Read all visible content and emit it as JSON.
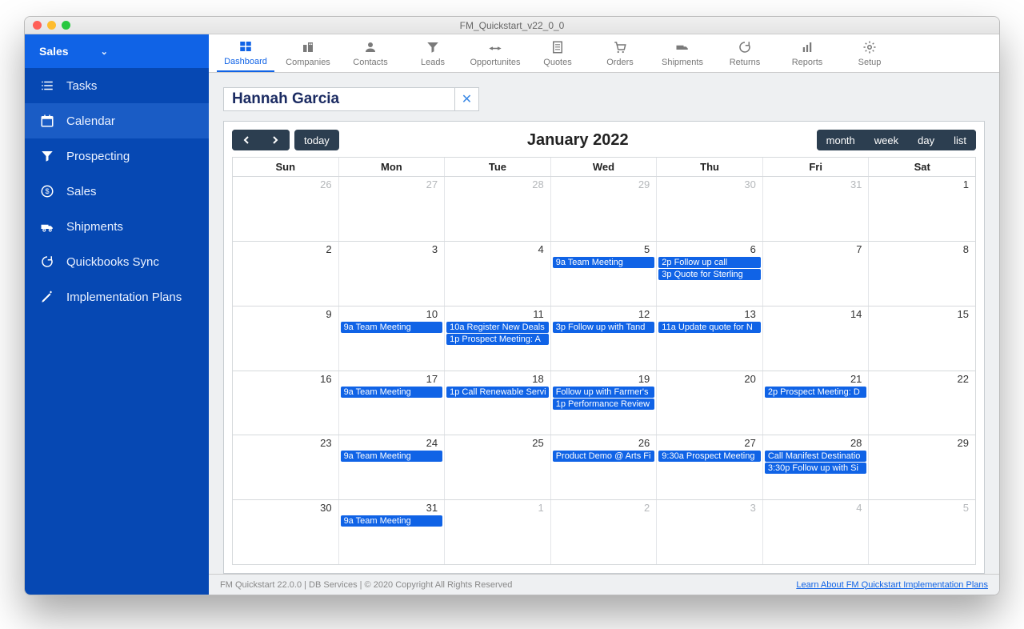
{
  "window_title": "FM_Quickstart_v22_0_0",
  "sidebar": {
    "header": "Sales",
    "items": [
      {
        "label": "Tasks",
        "icon": "list"
      },
      {
        "label": "Calendar",
        "icon": "calendar",
        "active": true
      },
      {
        "label": "Prospecting",
        "icon": "funnel"
      },
      {
        "label": "Sales",
        "icon": "money"
      },
      {
        "label": "Shipments",
        "icon": "truck"
      },
      {
        "label": "Quickbooks Sync",
        "icon": "sync"
      },
      {
        "label": "Implementation Plans",
        "icon": "pen"
      }
    ]
  },
  "toolbar": [
    {
      "label": "Dashboard",
      "active": true
    },
    {
      "label": "Companies"
    },
    {
      "label": "Contacts"
    },
    {
      "label": "Leads"
    },
    {
      "label": "Opportunites"
    },
    {
      "label": "Quotes"
    },
    {
      "label": "Orders"
    },
    {
      "label": "Shipments"
    },
    {
      "label": "Returns"
    },
    {
      "label": "Reports"
    },
    {
      "label": "Setup"
    }
  ],
  "user_name": "Hannah Garcia",
  "calendar": {
    "title": "January 2022",
    "today_label": "today",
    "views": [
      "month",
      "week",
      "day",
      "list"
    ],
    "day_headers": [
      "Sun",
      "Mon",
      "Tue",
      "Wed",
      "Thu",
      "Fri",
      "Sat"
    ],
    "weeks": [
      [
        {
          "num": "26",
          "other": true
        },
        {
          "num": "27",
          "other": true
        },
        {
          "num": "28",
          "other": true
        },
        {
          "num": "29",
          "other": true
        },
        {
          "num": "30",
          "other": true
        },
        {
          "num": "31",
          "other": true
        },
        {
          "num": "1"
        }
      ],
      [
        {
          "num": "2"
        },
        {
          "num": "3"
        },
        {
          "num": "4"
        },
        {
          "num": "5",
          "events": [
            "9a Team Meeting"
          ]
        },
        {
          "num": "6",
          "events": [
            "2p Follow up call",
            "3p Quote for Sterling"
          ]
        },
        {
          "num": "7"
        },
        {
          "num": "8"
        }
      ],
      [
        {
          "num": "9"
        },
        {
          "num": "10",
          "events": [
            "9a Team Meeting"
          ]
        },
        {
          "num": "11",
          "events": [
            "10a Register New Deals",
            "1p Prospect Meeting: A"
          ]
        },
        {
          "num": "12",
          "events": [
            "3p Follow up with Tand"
          ]
        },
        {
          "num": "13",
          "events": [
            "11a Update quote for N"
          ]
        },
        {
          "num": "14"
        },
        {
          "num": "15"
        }
      ],
      [
        {
          "num": "16"
        },
        {
          "num": "17",
          "events": [
            "9a Team Meeting"
          ]
        },
        {
          "num": "18",
          "events": [
            "1p Call Renewable Servi"
          ]
        },
        {
          "num": "19",
          "events": [
            "Follow up with Farmer's",
            "1p Performance Review"
          ]
        },
        {
          "num": "20"
        },
        {
          "num": "21",
          "events": [
            "2p Prospect Meeting: D"
          ]
        },
        {
          "num": "22"
        }
      ],
      [
        {
          "num": "23"
        },
        {
          "num": "24",
          "events": [
            "9a Team Meeting"
          ]
        },
        {
          "num": "25"
        },
        {
          "num": "26",
          "events": [
            "Product Demo @ Arts Fi"
          ]
        },
        {
          "num": "27",
          "events": [
            "9:30a Prospect Meeting"
          ]
        },
        {
          "num": "28",
          "events": [
            "Call Manifest Destinatio",
            "3:30p Follow up with Si"
          ]
        },
        {
          "num": "29"
        }
      ],
      [
        {
          "num": "30"
        },
        {
          "num": "31",
          "events": [
            "9a Team Meeting"
          ]
        },
        {
          "num": "1",
          "other": true
        },
        {
          "num": "2",
          "other": true
        },
        {
          "num": "3",
          "other": true
        },
        {
          "num": "4",
          "other": true
        },
        {
          "num": "5",
          "other": true
        }
      ]
    ]
  },
  "footer": {
    "left": "FM Quickstart 22.0.0  | DB Services | © 2020 Copyright All Rights Reserved",
    "right": "Learn About FM Quickstart Implementation Plans"
  }
}
